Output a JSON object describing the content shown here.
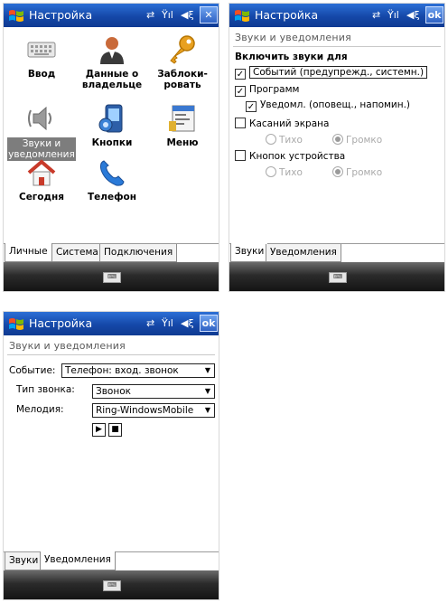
{
  "screen1": {
    "title": "Настройка",
    "close_label": "✕",
    "icons": [
      {
        "label": "Ввод"
      },
      {
        "label": "Данные о владельце"
      },
      {
        "label": "Заблоки-ровать"
      },
      {
        "label": "Звуки и уведомления"
      },
      {
        "label": "Кнопки"
      },
      {
        "label": "Меню"
      },
      {
        "label": "Сегодня"
      },
      {
        "label": "Телефон"
      }
    ],
    "tabs": [
      "Личные",
      "Система",
      "Подключения"
    ],
    "active_tab": "Личные"
  },
  "screen2": {
    "title": "Настройка",
    "ok_label": "ok",
    "header": "Звуки и уведомления",
    "section_title": "Включить звуки для",
    "options": [
      {
        "label": "Событий (предупрежд., системн.)",
        "checked": true
      },
      {
        "label": "Программ",
        "checked": true
      },
      {
        "label": "Уведомл. (оповещ., напомин.)",
        "checked": true
      },
      {
        "label": "Касаний экрана",
        "checked": false
      },
      {
        "label": "Кнопок устройства",
        "checked": false
      }
    ],
    "radio_quiet": "Тихо",
    "radio_loud": "Громко",
    "tabs": [
      "Звуки",
      "Уведомления"
    ],
    "active_tab": "Звуки"
  },
  "screen3": {
    "title": "Настройка",
    "ok_label": "ok",
    "header": "Звуки и уведомления",
    "event_label": "Событие:",
    "event_value": "Телефон: вход. звонок",
    "ring_type_label": "Тип звонка:",
    "ring_type_value": "Звонок",
    "melody_label": "Мелодия:",
    "melody_value": "Ring-WindowsMobile",
    "tabs": [
      "Звуки",
      "Уведомления"
    ],
    "active_tab": "Уведомления"
  },
  "colors": {
    "titlebar": "#1548a8",
    "softbar": "#2b2b2b",
    "selected": "#7d7d7d"
  }
}
